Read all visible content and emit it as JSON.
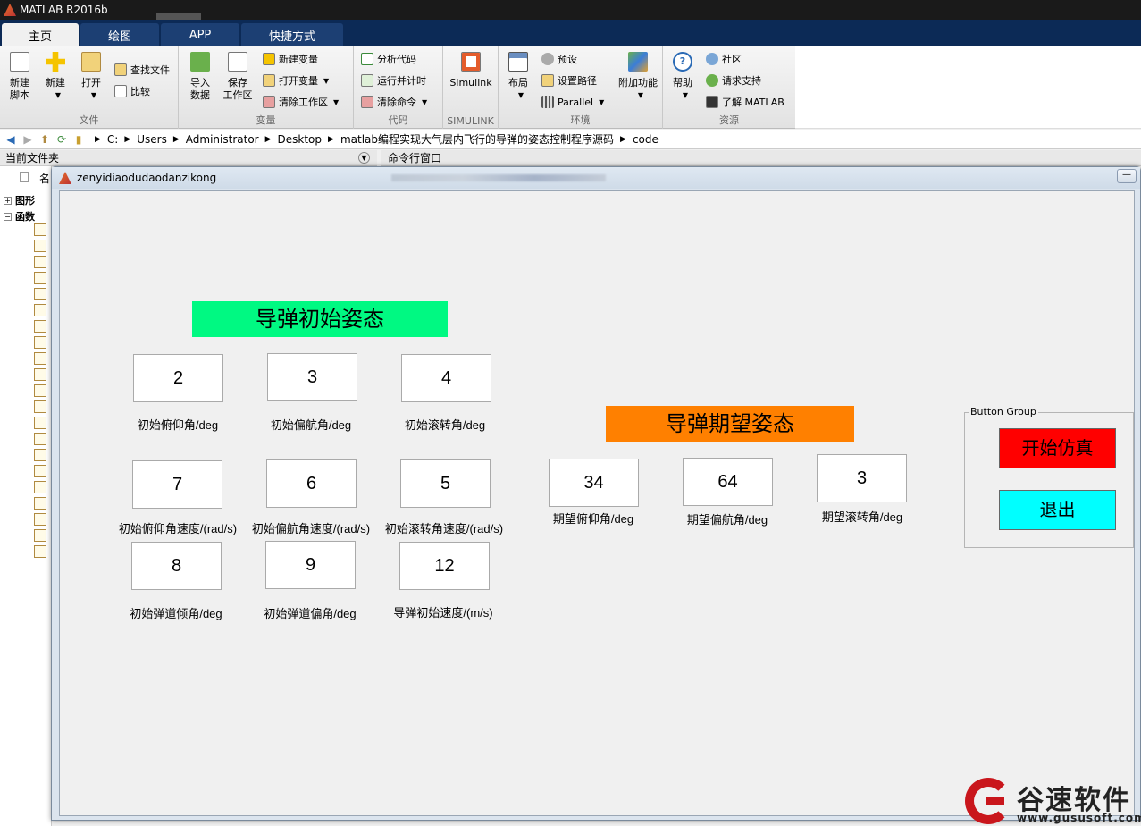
{
  "window": {
    "title": "MATLAB R2016b"
  },
  "ribbon_tabs": [
    {
      "label": "主页"
    },
    {
      "label": "绘图"
    },
    {
      "label": "APP"
    },
    {
      "label": "快捷方式"
    }
  ],
  "ribbon": {
    "file": {
      "label": "文件",
      "new_script": "新建\n脚本",
      "new": "新建",
      "open": "打开",
      "find_files": "查找文件",
      "compare": "比较"
    },
    "variable": {
      "label": "变量",
      "import_data": "导入\n数据",
      "save_workspace": "保存\n工作区",
      "new_variable": "新建变量",
      "open_variable": "打开变量",
      "clear_workspace": "清除工作区"
    },
    "code": {
      "label": "代码",
      "analyze_code": "分析代码",
      "run_and_time": "运行并计时",
      "clear_commands": "清除命令"
    },
    "simulink": {
      "label": "SIMULINK",
      "button": "Simulink"
    },
    "environment": {
      "label": "环境",
      "layout": "布局",
      "preferences": "预设",
      "set_path": "设置路径",
      "parallel": "Parallel",
      "addons": "附加功能"
    },
    "resources": {
      "label": "资源",
      "help": "帮助",
      "community": "社区",
      "request_support": "请求支持",
      "learn_matlab": "了解 MATLAB"
    }
  },
  "address": {
    "segments": [
      "C:",
      "Users",
      "Administrator",
      "Desktop",
      "matlab编程实现大气层内飞行的导弹的姿态控制程序源码",
      "code"
    ]
  },
  "panels": {
    "current_folder": "当前文件夹",
    "command_window": "命令行窗口",
    "name_header": "名",
    "tree_graphics": "图形",
    "tree_functions": "函数"
  },
  "figure": {
    "title": "zenyidiaodudaodanzikong",
    "initial_panel_title": "导弹初始姿态",
    "desired_panel_title": "导弹期望姿态",
    "fields": {
      "init_pitch": {
        "value": "2",
        "label": "初始俯仰角/deg"
      },
      "init_yaw": {
        "value": "3",
        "label": "初始偏航角/deg"
      },
      "init_roll": {
        "value": "4",
        "label": "初始滚转角/deg"
      },
      "init_pitch_rate": {
        "value": "7",
        "label": "初始俯仰角速度/(rad/s)"
      },
      "init_yaw_rate": {
        "value": "6",
        "label": "初始偏航角速度/(rad/s)"
      },
      "init_roll_rate": {
        "value": "5",
        "label": "初始滚转角速度/(rad/s)"
      },
      "init_traj_incl": {
        "value": "8",
        "label": "初始弹道倾角/deg"
      },
      "init_traj_yaw": {
        "value": "9",
        "label": "初始弹道偏角/deg"
      },
      "init_speed": {
        "value": "12",
        "label": "导弹初始速度/(m/s)"
      },
      "des_pitch": {
        "value": "34",
        "label": "期望俯仰角/deg"
      },
      "des_yaw": {
        "value": "64",
        "label": "期望偏航角/deg"
      },
      "des_roll": {
        "value": "3",
        "label": "期望滚转角/deg"
      }
    },
    "button_group": {
      "title": "Button Group",
      "start": "开始仿真",
      "exit": "退出"
    }
  },
  "watermark": {
    "name": "谷速软件",
    "url": "www.gususoft.com"
  },
  "colors": {
    "initial_panel_bg": "#00f982",
    "desired_panel_bg": "#ff8000",
    "start_button_bg": "#ff0000",
    "exit_button_bg": "#00ffff",
    "ribbon_tab_bg": "#0c2a56",
    "brand_red": "#c9161c"
  }
}
